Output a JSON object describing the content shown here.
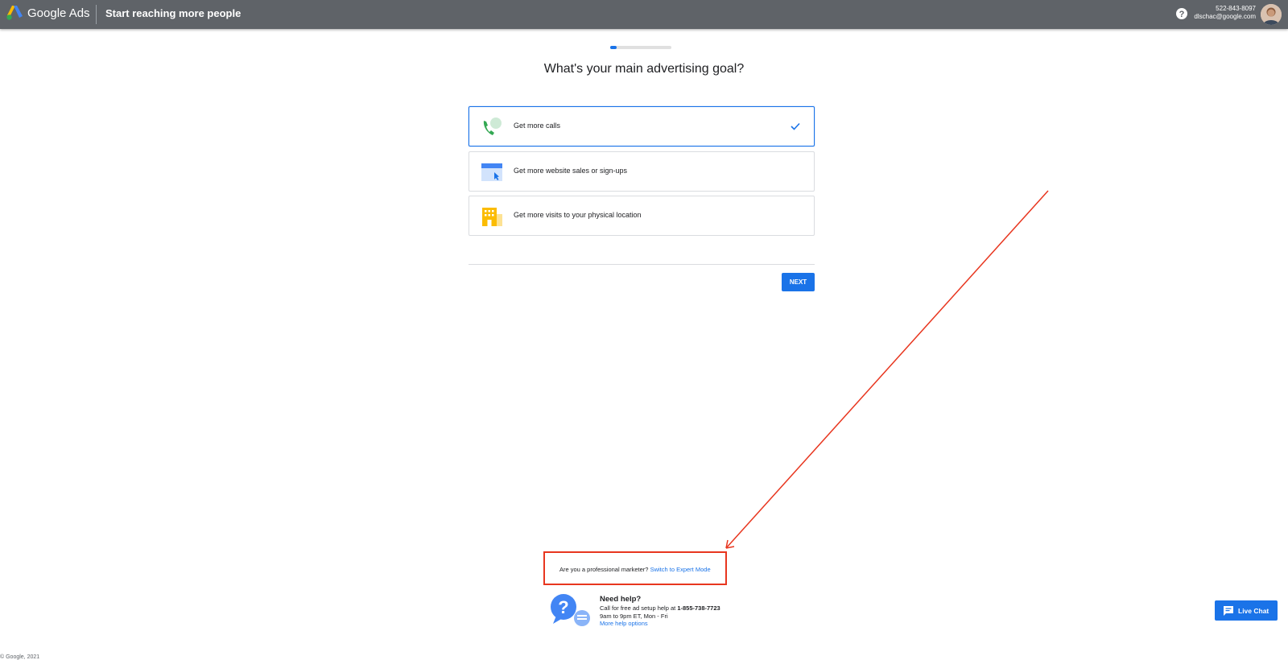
{
  "header": {
    "brand": "Google Ads",
    "page_heading": "Start reaching more people",
    "account_phone": "522-843-8097",
    "account_email": "dlschac@google.com"
  },
  "progress": {
    "fraction": 0.1
  },
  "main": {
    "title": "What's your main advertising goal?",
    "goals": [
      {
        "label": "Get more calls",
        "selected": true,
        "icon": "phone-call-icon"
      },
      {
        "label": "Get more website sales or sign-ups",
        "selected": false,
        "icon": "browser-click-icon"
      },
      {
        "label": "Get more visits to your physical location",
        "selected": false,
        "icon": "storefront-icon"
      }
    ],
    "next_label": "NEXT"
  },
  "expert": {
    "question": "Are you a professional marketer?",
    "link": "Switch to Expert Mode"
  },
  "help": {
    "title": "Need help?",
    "line1_prefix": "Call for free ad setup help at ",
    "phone": "1-855-738-7723",
    "hours": "9am to 9pm ET, Mon - Fri",
    "more_link": "More help options"
  },
  "live_chat_label": "Live Chat",
  "copyright": "© Google, 2021",
  "colors": {
    "primary": "#1a73e8",
    "topbar": "#5f6368",
    "annotation": "#e8361f"
  }
}
